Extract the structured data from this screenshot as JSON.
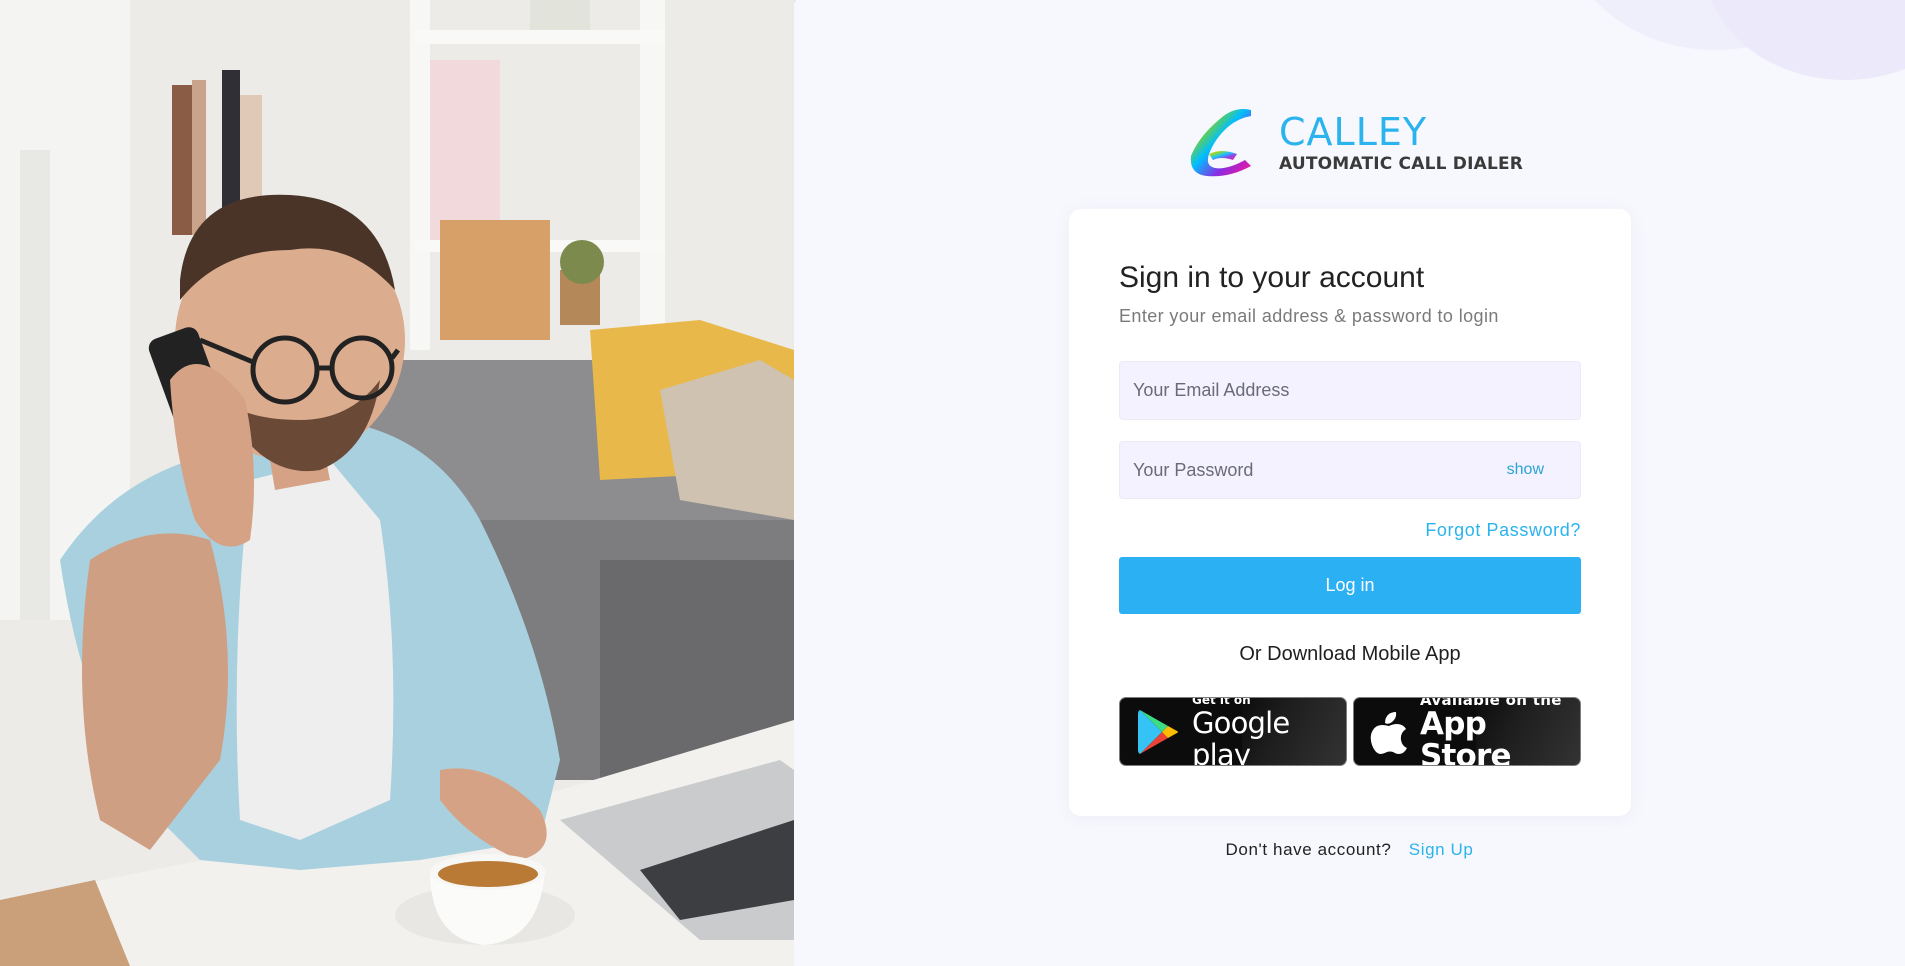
{
  "brand": {
    "name": "CALLEY",
    "tagline": "AUTOMATIC CALL DIALER"
  },
  "login": {
    "title": "Sign in to your account",
    "subtitle": "Enter your email address & password to login",
    "email_placeholder": "Your Email Address",
    "password_placeholder": "Your Password",
    "show_label": "show",
    "forgot_label": "Forgot Password?",
    "login_label": "Log in",
    "download_label": "Or Download Mobile App"
  },
  "stores": {
    "google": {
      "small": "Get it on",
      "large": "Google play"
    },
    "apple": {
      "small": "Available on the",
      "large": "App Store"
    }
  },
  "signup": {
    "prompt": "Don't have account?",
    "link": "Sign Up"
  },
  "colors": {
    "accent": "#2bb3ed",
    "button": "#2cb0f4",
    "input_bg": "#f3f2fe",
    "page_bg": "#f7f8fd"
  },
  "icons": [
    "calley-logo-icon",
    "google-play-icon",
    "apple-icon"
  ]
}
